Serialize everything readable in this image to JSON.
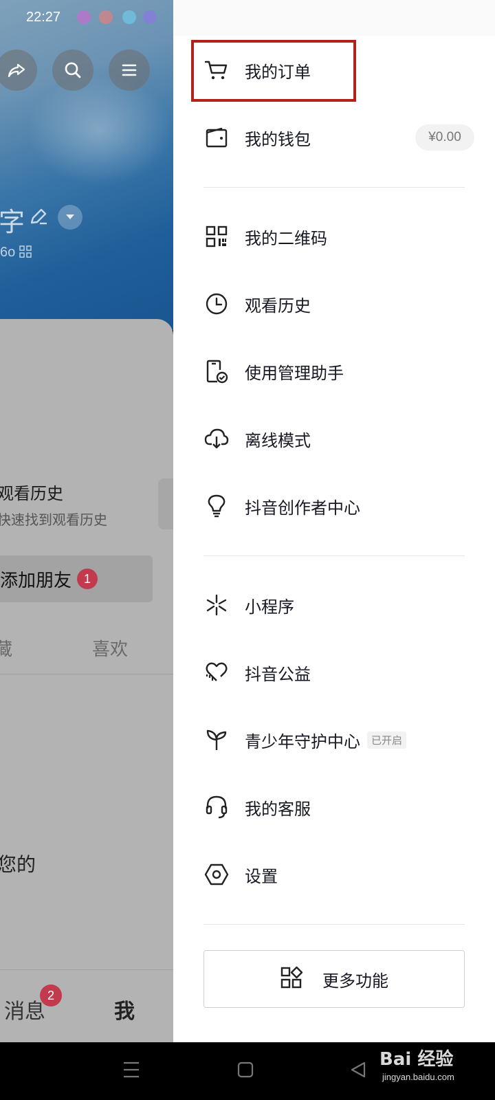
{
  "status_bar": {
    "time": "22:27"
  },
  "profile_bg": {
    "name_fragment": "字",
    "id_fragment": "6o",
    "history_card": {
      "title": "观看历史",
      "subtitle": "快速找到观看历史"
    },
    "add_friend": {
      "label": "添加朋友",
      "badge": "1"
    },
    "tabs": {
      "partial": "藏",
      "likes": "喜欢"
    },
    "body_fragment": "您的",
    "bottom_nav": {
      "messages": "消息",
      "messages_badge": "2",
      "me": "我"
    }
  },
  "drawer": {
    "menu_groups": [
      [
        {
          "label": "我的订单",
          "icon": "cart-icon"
        },
        {
          "label": "我的钱包",
          "icon": "wallet-icon",
          "value": "¥0.00"
        }
      ],
      [
        {
          "label": "我的二维码",
          "icon": "qr-code-icon"
        },
        {
          "label": "观看历史",
          "icon": "clock-icon"
        },
        {
          "label": "使用管理助手",
          "icon": "phone-check-icon"
        },
        {
          "label": "离线模式",
          "icon": "cloud-download-icon"
        },
        {
          "label": "抖音创作者中心",
          "icon": "lightbulb-icon"
        }
      ],
      [
        {
          "label": "小程序",
          "icon": "mini-program-icon"
        },
        {
          "label": "抖音公益",
          "icon": "charity-heart-icon"
        },
        {
          "label": "青少年守护中心",
          "icon": "sprout-icon",
          "tag": "已开启"
        },
        {
          "label": "我的客服",
          "icon": "headset-icon"
        },
        {
          "label": "设置",
          "icon": "settings-hex-icon"
        }
      ]
    ],
    "more_button": {
      "label": "更多功能",
      "icon": "grid-shapes-icon"
    },
    "highlight_color": "#b2221a"
  },
  "watermark": {
    "main": "Bai 经验",
    "sub": "jingyan.baidu.com"
  }
}
